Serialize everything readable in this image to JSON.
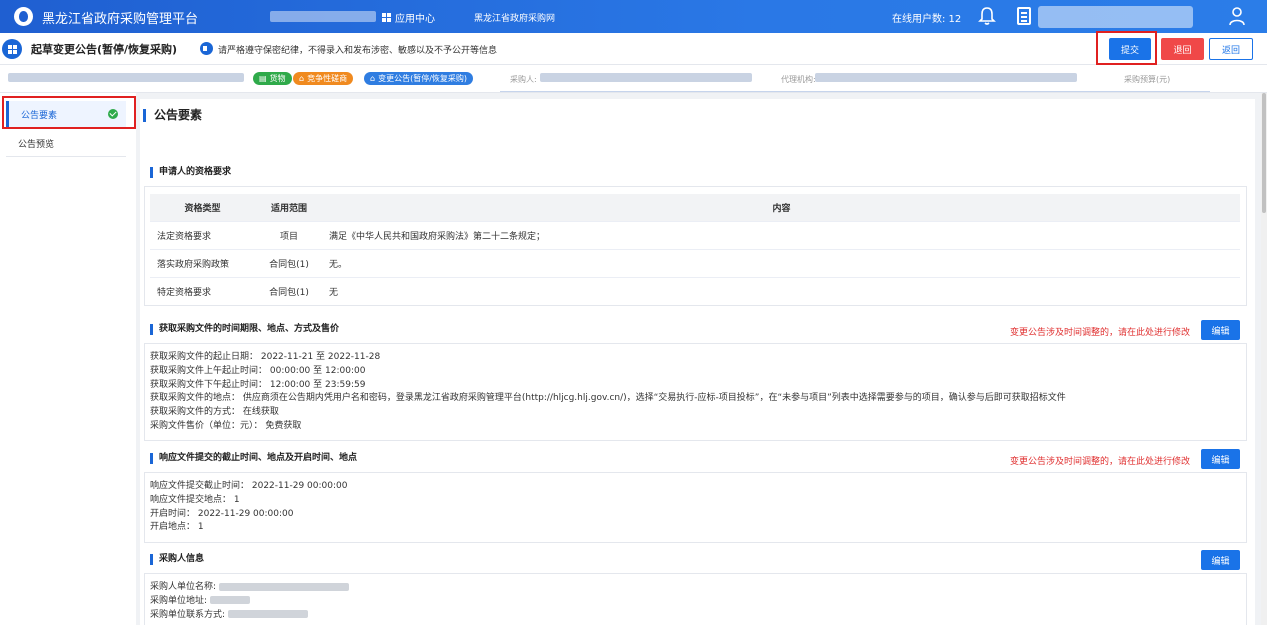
{
  "topbar": {
    "title": "黑龙江省政府采购管理平台",
    "app_center": "应用中心",
    "site_link": "黑龙江省政府采购网",
    "online_label": "在线用户数: 12"
  },
  "subbar": {
    "page_title": "起草变更公告(暂停/恢复采购)",
    "notice": "请严格遵守保密纪律，不得录入和发布涉密、敏感以及不予公开等信息",
    "submit": "提交",
    "back": "退回",
    "return": "返回"
  },
  "infobar": {
    "tags": [
      "货物",
      "竞争性磋商",
      "变更公告(暂停/恢复采购)"
    ],
    "purchaser_label": "采购人:",
    "agency_label": "代理机构:",
    "budget_label": "采购预算(元)"
  },
  "sidebar": {
    "items": [
      {
        "label": "公告要素"
      },
      {
        "label": "公告预览"
      }
    ]
  },
  "main": {
    "title": "公告要素",
    "qualification": {
      "title": "申请人的资格要求",
      "headers": [
        "资格类型",
        "适用范围",
        "内容"
      ],
      "rows": [
        [
          "法定资格要求",
          "项目",
          "满足《中华人民共和国政府采购法》第二十二条规定；"
        ],
        [
          "落实政府采购政策",
          "合同包(1)",
          "无。"
        ],
        [
          "特定资格要求",
          "合同包(1)",
          "无"
        ]
      ]
    },
    "acquire": {
      "title": "获取采购文件的时间期限、地点、方式及售价",
      "hint": "变更公告涉及时间调整的，请在此处进行修改",
      "edit": "编辑",
      "lines": [
        "获取采购文件的起止日期： 2022-11-21 至 2022-11-28",
        "获取采购文件上午起止时间： 00:00:00 至 12:00:00",
        "获取采购文件下午起止时间： 12:00:00 至 23:59:59",
        "获取采购文件的地点： 供应商须在公告期内凭用户名和密码，登录黑龙江省政府采购管理平台(http://hljcg.hlj.gov.cn/)，选择“交易执行-应标-项目投标”，在“未参与项目”列表中选择需要参与的项目，确认参与后即可获取招标文件",
        "获取采购文件的方式： 在线获取",
        "采购文件售价（单位：元）： 免费获取"
      ]
    },
    "response": {
      "title": "响应文件提交的截止时间、地点及开启时间、地点",
      "hint": "变更公告涉及时间调整的，请在此处进行修改",
      "edit": "编辑",
      "lines": [
        "响应文件提交截止时间： 2022-11-29 00:00:00",
        "响应文件提交地点： 1",
        "开启时间： 2022-11-29 00:00:00",
        "开启地点： 1"
      ]
    },
    "purchaser": {
      "title": "采购人信息",
      "edit": "编辑",
      "lines": [
        "采购人单位名称:",
        "采购单位地址:",
        "采购单位联系方式:"
      ]
    }
  },
  "colors": {
    "primary": "#1a73e8",
    "danger": "#f04848",
    "success": "#2faa4a",
    "warning": "#f08a1f",
    "highlight": "#e02020"
  }
}
